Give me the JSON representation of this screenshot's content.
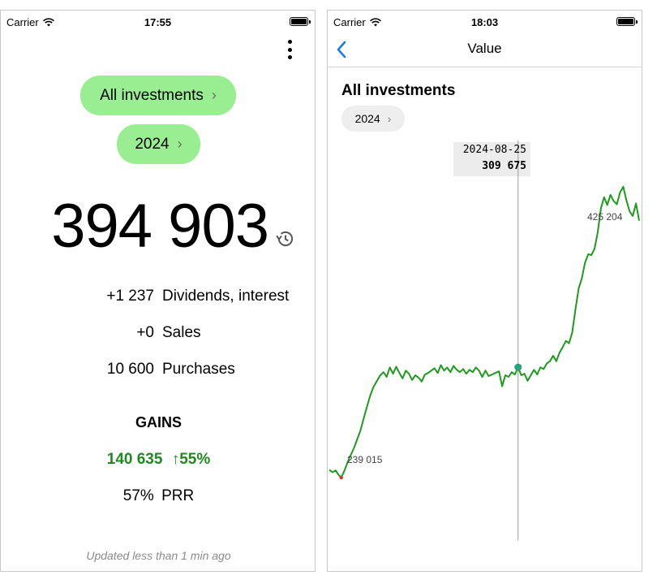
{
  "left": {
    "status": {
      "carrier": "Carrier",
      "time": "17:55"
    },
    "menu_icon": "more-vertical-icon",
    "scope_label": "All investments",
    "year_label": "2024",
    "chevron": "›",
    "total_value": "394 903",
    "history_icon": "history-icon",
    "rows": [
      {
        "value": "+1 237",
        "label": "Dividends, interest"
      },
      {
        "value": "+0",
        "label": "Sales"
      },
      {
        "value": "10 600",
        "label": "Purchases"
      }
    ],
    "gains_title": "GAINS",
    "gains_value": "140 635",
    "gains_arrow": "↑",
    "gains_pct": "55%",
    "prr_value": "57%",
    "prr_label": "PRR",
    "updated": "Updated less than 1 min ago"
  },
  "right": {
    "status": {
      "carrier": "Carrier",
      "time": "18:03"
    },
    "nav_title": "Value",
    "chart_title": "All investments",
    "year_label": "2024",
    "chevron": "›"
  },
  "colors": {
    "accent_green": "#98ee90",
    "gains_green": "#1f8a1f",
    "line_green": "#1e9a1e",
    "ios_blue": "#1a7cf0",
    "marker_teal": "#2aa37a",
    "min_marker": "#d9342b"
  },
  "chart_data": {
    "type": "line",
    "title": "",
    "series": [
      {
        "points": [
          [
            "2024-01-01",
            244000
          ],
          [
            "2024-01-05",
            242500
          ],
          [
            "2024-01-09",
            243600
          ],
          [
            "2024-01-12",
            241200
          ],
          [
            "2024-01-16",
            239015
          ],
          [
            "2024-01-20",
            243500
          ],
          [
            "2024-01-24",
            249000
          ],
          [
            "2024-01-28",
            253500
          ],
          [
            "2024-02-01",
            258000
          ],
          [
            "2024-02-05",
            263500
          ],
          [
            "2024-02-09",
            269000
          ],
          [
            "2024-02-13",
            276500
          ],
          [
            "2024-02-17",
            284000
          ],
          [
            "2024-02-21",
            291000
          ],
          [
            "2024-02-25",
            296500
          ],
          [
            "2024-03-01",
            301000
          ],
          [
            "2024-03-05",
            304500
          ],
          [
            "2024-03-09",
            306500
          ],
          [
            "2024-03-13",
            303500
          ],
          [
            "2024-03-17",
            309500
          ],
          [
            "2024-03-21",
            305500
          ],
          [
            "2024-03-25",
            310000
          ],
          [
            "2024-03-29",
            306000
          ],
          [
            "2024-04-02",
            302500
          ],
          [
            "2024-04-06",
            307500
          ],
          [
            "2024-04-10",
            305500
          ],
          [
            "2024-04-14",
            301500
          ],
          [
            "2024-04-18",
            304500
          ],
          [
            "2024-04-22",
            303000
          ],
          [
            "2024-04-26",
            300500
          ],
          [
            "2024-04-30",
            305000
          ],
          [
            "2024-05-04",
            306000
          ],
          [
            "2024-05-08",
            307500
          ],
          [
            "2024-05-12",
            309000
          ],
          [
            "2024-05-16",
            306000
          ],
          [
            "2024-05-20",
            311000
          ],
          [
            "2024-05-24",
            307500
          ],
          [
            "2024-05-28",
            309500
          ],
          [
            "2024-06-01",
            306500
          ],
          [
            "2024-06-05",
            310500
          ],
          [
            "2024-06-09",
            308000
          ],
          [
            "2024-06-13",
            306500
          ],
          [
            "2024-06-17",
            308500
          ],
          [
            "2024-06-21",
            305500
          ],
          [
            "2024-06-25",
            308000
          ],
          [
            "2024-06-29",
            306500
          ],
          [
            "2024-07-03",
            309500
          ],
          [
            "2024-07-07",
            307500
          ],
          [
            "2024-07-11",
            303500
          ],
          [
            "2024-07-15",
            307500
          ],
          [
            "2024-07-19",
            304000
          ],
          [
            "2024-08-01",
            307000
          ],
          [
            "2024-08-05",
            297500
          ],
          [
            "2024-08-09",
            304500
          ],
          [
            "2024-08-13",
            303500
          ],
          [
            "2024-08-17",
            306500
          ],
          [
            "2024-08-21",
            305000
          ],
          [
            "2024-08-25",
            309675
          ],
          [
            "2024-08-29",
            304500
          ],
          [
            "2024-09-02",
            305500
          ],
          [
            "2024-09-06",
            301000
          ],
          [
            "2024-09-10",
            304500
          ],
          [
            "2024-09-14",
            308000
          ],
          [
            "2024-09-18",
            305000
          ],
          [
            "2024-09-22",
            309500
          ],
          [
            "2024-09-26",
            308500
          ],
          [
            "2024-09-30",
            312000
          ],
          [
            "2024-10-04",
            313500
          ],
          [
            "2024-10-08",
            317000
          ],
          [
            "2024-10-12",
            313500
          ],
          [
            "2024-10-16",
            319000
          ],
          [
            "2024-10-20",
            322500
          ],
          [
            "2024-10-24",
            326500
          ],
          [
            "2024-10-28",
            325000
          ],
          [
            "2024-11-01",
            332000
          ],
          [
            "2024-11-05",
            346500
          ],
          [
            "2024-11-09",
            360000
          ],
          [
            "2024-11-13",
            366500
          ],
          [
            "2024-11-17",
            376500
          ],
          [
            "2024-11-21",
            382000
          ],
          [
            "2024-11-25",
            381500
          ],
          [
            "2024-11-29",
            385500
          ],
          [
            "2024-12-03",
            396000
          ],
          [
            "2024-12-07",
            411500
          ],
          [
            "2024-12-11",
            418500
          ],
          [
            "2024-12-15",
            413500
          ],
          [
            "2024-12-19",
            420000
          ],
          [
            "2024-12-23",
            416000
          ],
          [
            "2024-12-27",
            414000
          ],
          [
            "2024-12-31",
            421500
          ],
          [
            "2025-01-04",
            425204
          ],
          [
            "2025-01-08",
            416500
          ],
          [
            "2025-01-12",
            409500
          ],
          [
            "2025-01-16",
            406500
          ],
          [
            "2025-01-20",
            414500
          ],
          [
            "2025-01-24",
            403500
          ]
        ]
      }
    ],
    "x_range": [
      "2024-01-01",
      "2025-01-24"
    ],
    "y_range": [
      200000,
      460000
    ],
    "grid": false,
    "selected": {
      "date": "2024-08-25",
      "value": "309 675"
    },
    "max": {
      "date": "2025-01-04",
      "value": "425 204"
    },
    "min": {
      "date": "2024-01-16",
      "value": "239 015"
    }
  }
}
